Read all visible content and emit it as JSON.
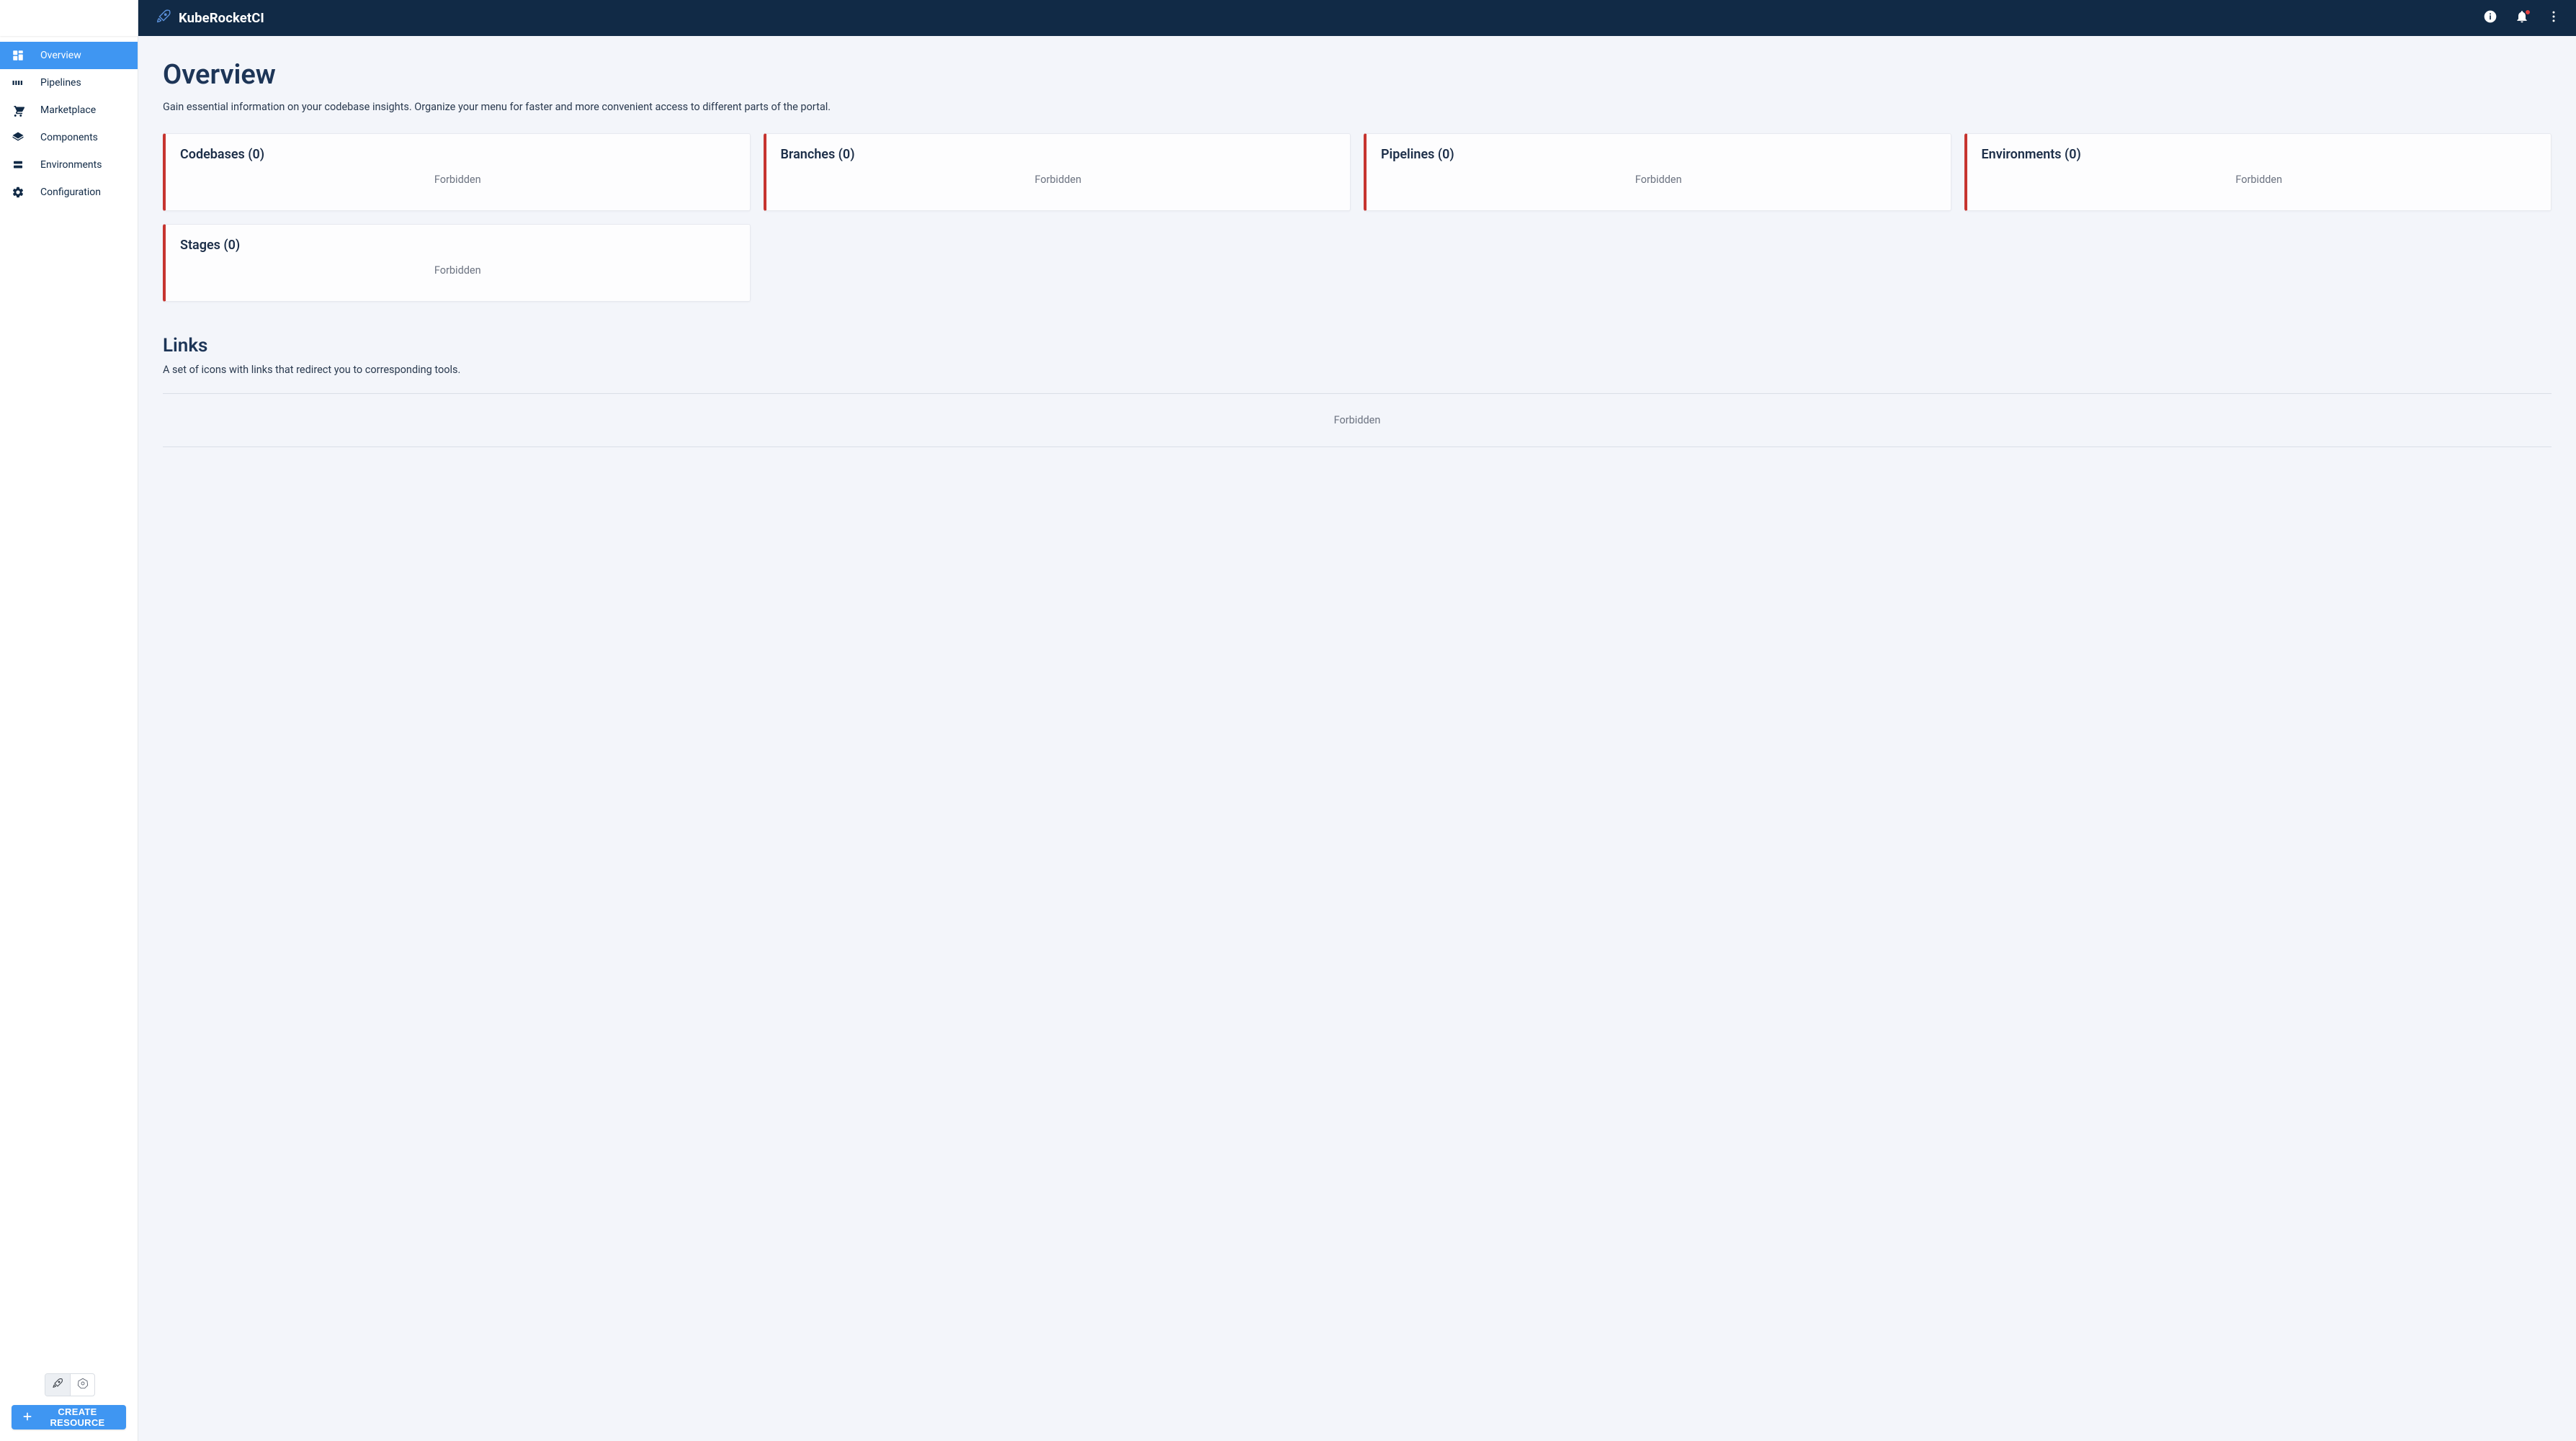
{
  "header": {
    "brand": "KubeRocketCI"
  },
  "sidebar": {
    "items": [
      {
        "label": "Overview",
        "icon": "dashboard-icon",
        "active": true
      },
      {
        "label": "Pipelines",
        "icon": "pipelines-icon",
        "active": false
      },
      {
        "label": "Marketplace",
        "icon": "cart-icon",
        "active": false
      },
      {
        "label": "Components",
        "icon": "layers-icon",
        "active": false
      },
      {
        "label": "Environments",
        "icon": "stack-icon",
        "active": false
      },
      {
        "label": "Configuration",
        "icon": "gear-icon",
        "active": false
      }
    ],
    "create_button": "CREATE RESOURCE"
  },
  "main": {
    "title": "Overview",
    "description": "Gain essential information on your codebase insights. Organize your menu for faster and more convenient access to different parts of the portal.",
    "cards": [
      {
        "title": "Codebases (0)",
        "status": "Forbidden"
      },
      {
        "title": "Branches (0)",
        "status": "Forbidden"
      },
      {
        "title": "Pipelines (0)",
        "status": "Forbidden"
      },
      {
        "title": "Environments (0)",
        "status": "Forbidden"
      },
      {
        "title": "Stages (0)",
        "status": "Forbidden"
      }
    ],
    "links_section": {
      "title": "Links",
      "description": "A set of icons with links that redirect you to corresponding tools.",
      "status": "Forbidden"
    }
  }
}
